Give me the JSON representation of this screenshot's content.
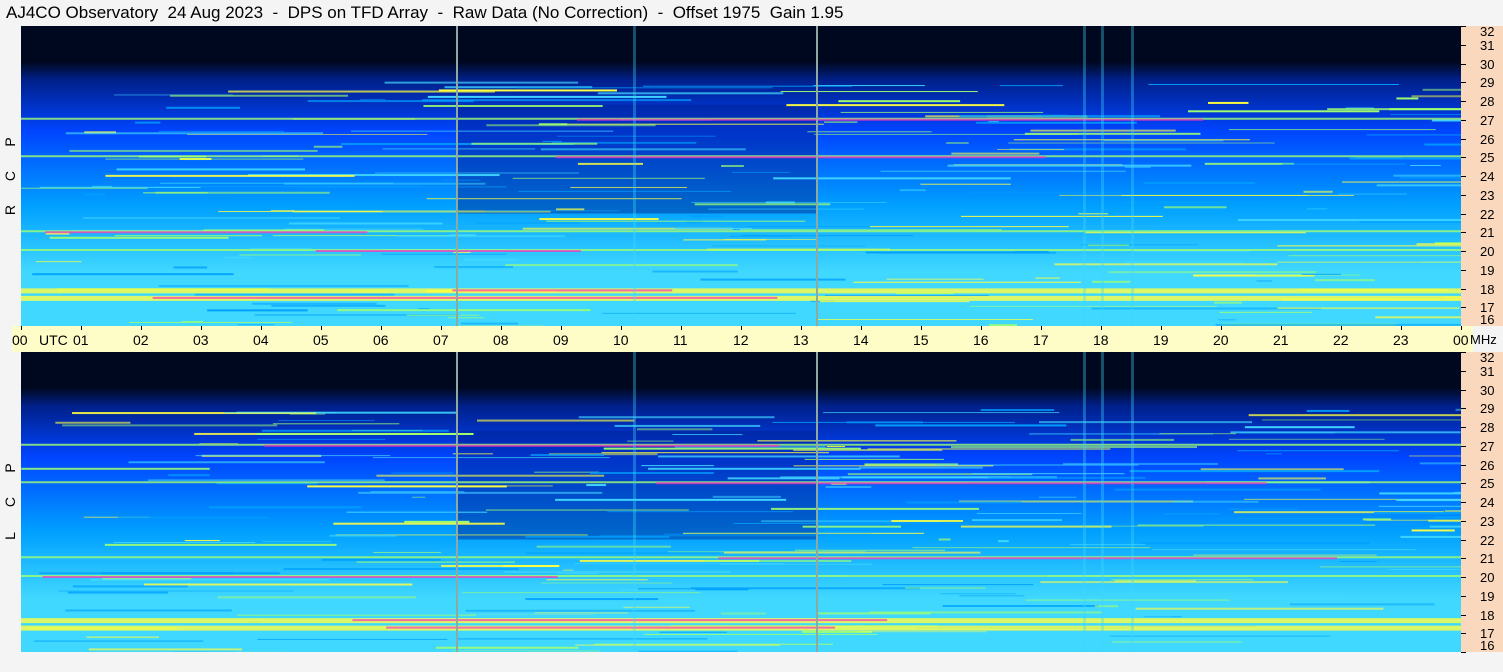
{
  "title": "AJ4CO Observatory  24 Aug 2023  -  DPS on TFD Array  -  Raw Data (No Correction)  -  Offset 1975  Gain 1.95",
  "chart_data": [
    {
      "type": "heatmap",
      "polarization": [
        "R",
        "C",
        "P"
      ],
      "x_unit": "UTC",
      "y_unit": "MHz",
      "xlim": [
        0,
        24
      ],
      "ylim": [
        16,
        32
      ],
      "x_ticks": [
        "00",
        "01",
        "02",
        "03",
        "04",
        "05",
        "06",
        "07",
        "08",
        "09",
        "10",
        "11",
        "12",
        "13",
        "14",
        "15",
        "16",
        "17",
        "18",
        "19",
        "20",
        "21",
        "22",
        "23",
        "00"
      ],
      "y_ticks": [
        "16",
        "17",
        "18",
        "19",
        "20",
        "21",
        "22",
        "23",
        "24",
        "25",
        "26",
        "27",
        "28",
        "29",
        "30",
        "31",
        "32"
      ],
      "intense_bands_mhz": [
        17.5,
        17.9,
        20,
        21,
        25,
        27
      ],
      "vertical_markers_utc": [
        7.25,
        13.25
      ],
      "colormap": [
        "#000820",
        "#00208a",
        "#0044ff",
        "#00a0ff",
        "#40d8ff",
        "#a0ff70",
        "#ffff40",
        "#ff8040",
        "#ff30c0"
      ]
    },
    {
      "type": "heatmap",
      "polarization": [
        "L",
        "C",
        "P"
      ],
      "x_unit": "UTC",
      "y_unit": "MHz",
      "xlim": [
        0,
        24
      ],
      "ylim": [
        16,
        32
      ],
      "x_ticks": [
        "00",
        "01",
        "02",
        "03",
        "04",
        "05",
        "06",
        "07",
        "08",
        "09",
        "10",
        "11",
        "12",
        "13",
        "14",
        "15",
        "16",
        "17",
        "18",
        "19",
        "20",
        "21",
        "22",
        "23",
        "00"
      ],
      "y_ticks": [
        "16",
        "17",
        "18",
        "19",
        "20",
        "21",
        "22",
        "23",
        "24",
        "25",
        "26",
        "27",
        "28",
        "29",
        "30",
        "31",
        "32"
      ],
      "intense_bands_mhz": [
        17.3,
        17.7,
        20,
        21,
        25,
        27
      ],
      "vertical_markers_utc": [
        7.25,
        13.25
      ],
      "colormap": [
        "#000820",
        "#00208a",
        "#0044ff",
        "#00a0ff",
        "#40d8ff",
        "#a0ff70",
        "#ffff40",
        "#ff8040",
        "#ff30c0"
      ]
    }
  ],
  "time_axis": {
    "utc_label": "UTC",
    "mhz_label": "MHz"
  }
}
